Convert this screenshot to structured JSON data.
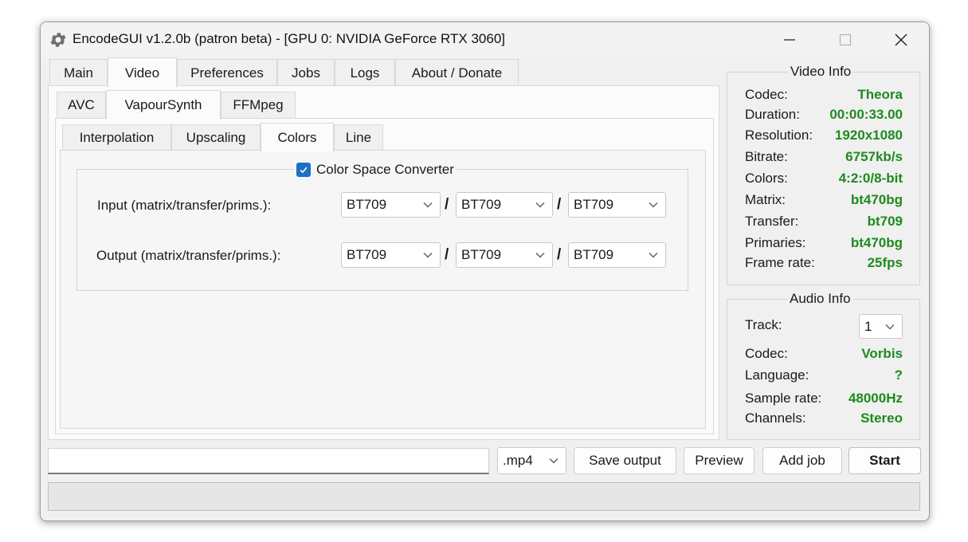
{
  "window": {
    "title": "EncodeGUI v1.2.0b (patron beta) - [GPU 0: NVIDIA GeForce RTX 3060]",
    "icon": "gear-icon"
  },
  "main_tabs": [
    "Main",
    "Video",
    "Preferences",
    "Jobs",
    "Logs",
    "About / Donate"
  ],
  "video_tabs": [
    "AVC",
    "VapourSynth",
    "FFMpeg"
  ],
  "vs_tabs": [
    "Interpolation",
    "Upscaling",
    "Colors",
    "Line"
  ],
  "color_converter": {
    "label": "Color Space Converter",
    "checked": true,
    "input_label": "Input (matrix/transfer/prims.):",
    "output_label": "Output (matrix/transfer/prims.):",
    "separator": "/",
    "input_values": [
      "BT709",
      "BT709",
      "BT709"
    ],
    "output_values": [
      "BT709",
      "BT709",
      "BT709"
    ]
  },
  "video_info": {
    "title": "Video Info",
    "rows": [
      {
        "label": "Codec:",
        "value": "Theora"
      },
      {
        "label": "Duration:",
        "value": "00:00:33.00"
      },
      {
        "label": "Resolution:",
        "value": "1920x1080"
      },
      {
        "label": "Bitrate:",
        "value": "6757kb/s"
      },
      {
        "label": "Colors:",
        "value": "4:2:0/8-bit"
      },
      {
        "label": "Matrix:",
        "value": "bt470bg"
      },
      {
        "label": "Transfer:",
        "value": "bt709"
      },
      {
        "label": "Primaries:",
        "value": "bt470bg"
      },
      {
        "label": "Frame rate:",
        "value": "25fps"
      }
    ]
  },
  "audio_info": {
    "title": "Audio Info",
    "track_label": "Track:",
    "track_value": "1",
    "rows": [
      {
        "label": "Codec:",
        "value": "Vorbis"
      },
      {
        "label": "Language:",
        "value": "?"
      },
      {
        "label": "Sample rate:",
        "value": "48000Hz"
      },
      {
        "label": "Channels:",
        "value": "Stereo"
      }
    ]
  },
  "bottom": {
    "output_path": "",
    "container": ".mp4",
    "save_output": "Save output",
    "preview": "Preview",
    "add_job": "Add job",
    "start": "Start",
    "progress": 0
  },
  "colors": {
    "value_green": "#1e8a1e",
    "checkbox_blue": "#1f6fc5"
  }
}
